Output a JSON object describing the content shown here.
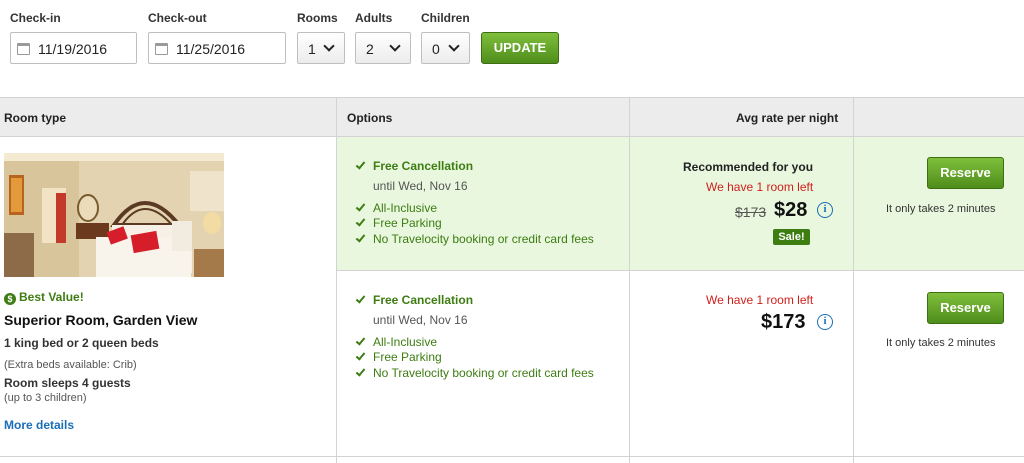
{
  "search": {
    "checkin_label": "Check-in",
    "checkin_value": "11/19/2016",
    "checkout_label": "Check-out",
    "checkout_value": "11/25/2016",
    "rooms_label": "Rooms",
    "rooms_value": "1",
    "adults_label": "Adults",
    "adults_value": "2",
    "children_label": "Children",
    "children_value": "0",
    "update_label": "UPDATE"
  },
  "table": {
    "headers": [
      "Room type",
      "Options",
      "Avg rate per night"
    ]
  },
  "room": {
    "badge": "Best Value!",
    "name": "Superior Room, Garden View",
    "beds": "1 king bed or 2 queen beds",
    "extra_beds": "(Extra beds available: Crib)",
    "sleeps": "Room sleeps 4 guests",
    "children": "(up to 3 children)",
    "more_details": "More details"
  },
  "options": [
    {
      "free_cancellation": "Free Cancellation",
      "until": "until Wed, Nov 16",
      "amenities": [
        "All-Inclusive",
        "Free Parking",
        "No Travelocity booking or credit card fees"
      ],
      "recommended": "Recommended for you",
      "rooms_left": "We have 1 room left",
      "old_price": "$173",
      "price": "$28",
      "sale_badge": "Sale!",
      "reserve_label": "Reserve",
      "takes": "It only takes 2 minutes"
    },
    {
      "free_cancellation": "Free Cancellation",
      "until": "until Wed, Nov 16",
      "amenities": [
        "All-Inclusive",
        "Free Parking",
        "No Travelocity booking or credit card fees"
      ],
      "rooms_left": "We have 1 room left",
      "price": "$173",
      "reserve_label": "Reserve",
      "takes": "It only takes 2 minutes"
    }
  ],
  "colors": {
    "accent_green": "#4f8d1b",
    "highlight_bg": "#e8f7de",
    "warning_red": "#d0201c",
    "link_blue": "#1a6fb7"
  }
}
